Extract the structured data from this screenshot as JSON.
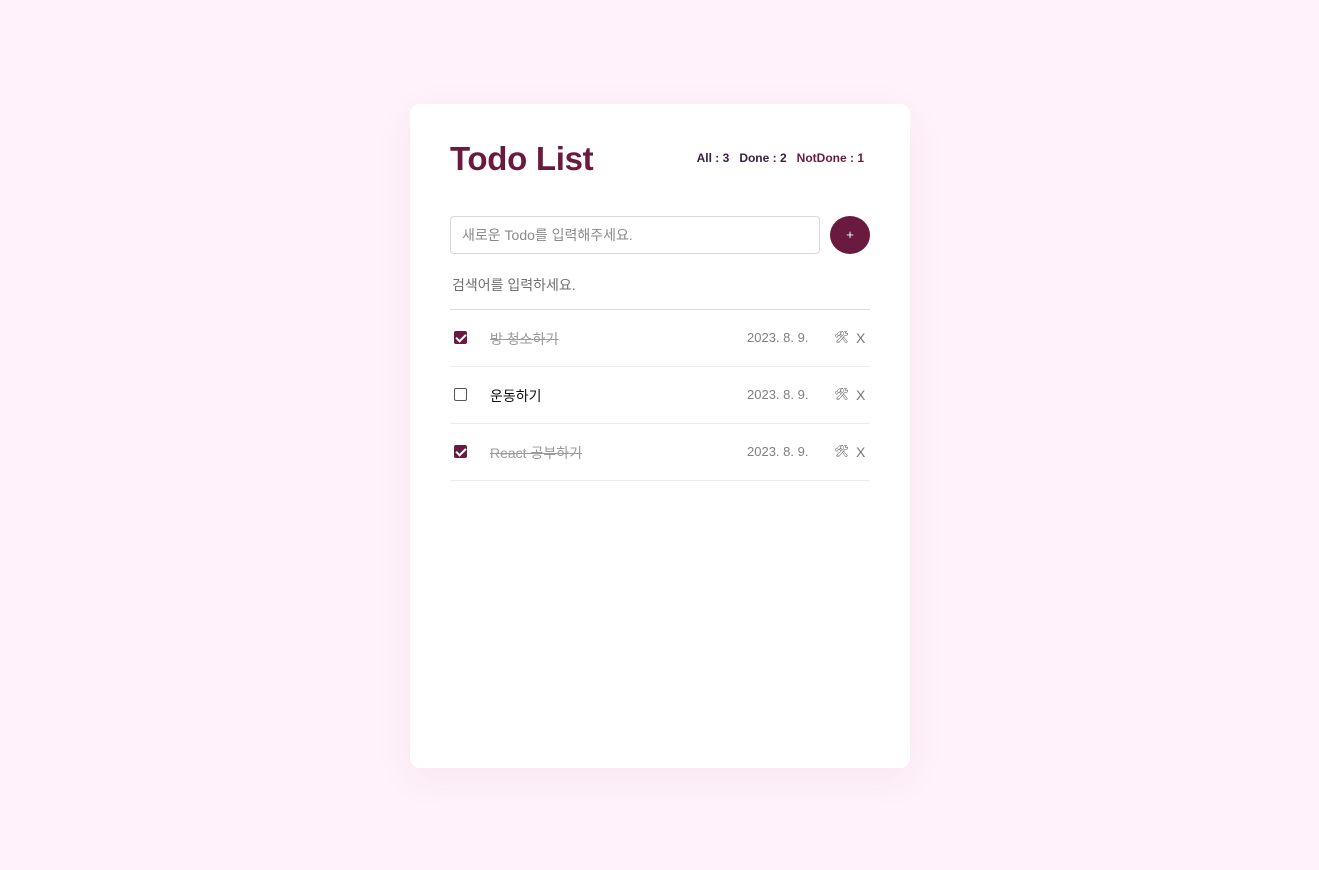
{
  "header": {
    "title": "Todo List",
    "stats": {
      "all": "All : 3",
      "done": "Done : 2",
      "not_done": "NotDone : 1"
    }
  },
  "editor": {
    "placeholder": "새로운 Todo를 입력해주세요.",
    "add_label": "+"
  },
  "search": {
    "placeholder": "검색어를 입력하세요."
  },
  "todos": [
    {
      "checked": true,
      "content": "방 청소하기",
      "date": "2023. 8. 9.",
      "edit_icon": "🛠",
      "delete_label": "X"
    },
    {
      "checked": false,
      "content": "운동하기",
      "date": "2023. 8. 9.",
      "edit_icon": "🛠",
      "delete_label": "X"
    },
    {
      "checked": true,
      "content": "React 공부하기",
      "date": "2023. 8. 9.",
      "edit_icon": "🛠",
      "delete_label": "X"
    }
  ],
  "colors": {
    "accent": "#6b1a3f",
    "background": "#fff2fa"
  }
}
